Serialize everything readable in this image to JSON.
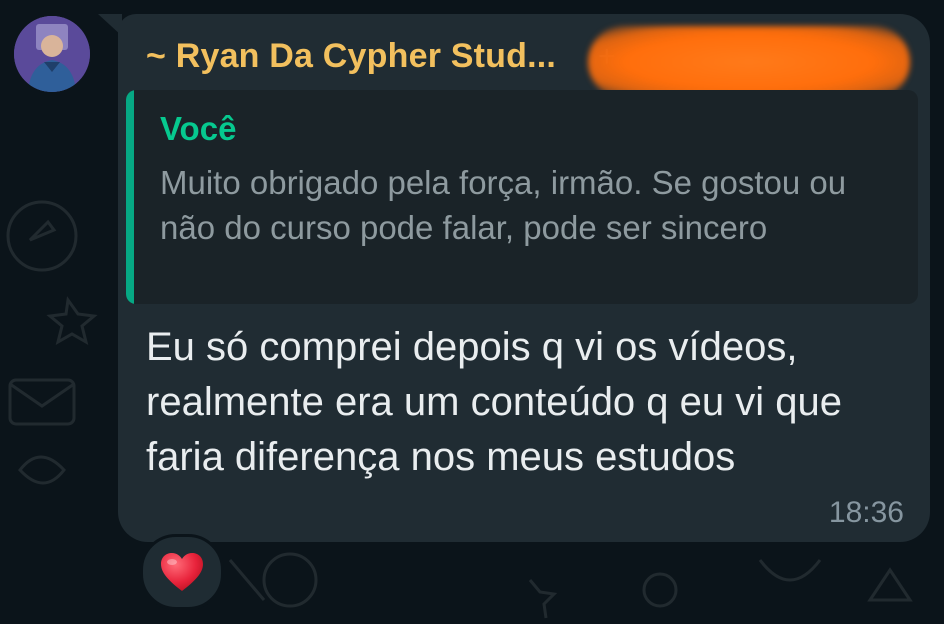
{
  "chat": {
    "sender": {
      "name": "~ Ryan Da Cypher Stud...",
      "phone": "+",
      "name_color": "#f2c05e"
    },
    "quoted_message": {
      "author": "Você",
      "text": "Muito obrigado pela força, irmão. Se gostou ou não do curso pode falar, pode ser sincero",
      "accent_color": "#06a884"
    },
    "message": {
      "text": "Eu só comprei depois q vi os vídeos, realmente era um conteúdo q eu vi que faria diferença nos meus estudos",
      "time": "18:36"
    },
    "reaction": {
      "emoji": "heart-icon"
    }
  },
  "theme": {
    "background": "#0b141a",
    "bubble": "#202c33",
    "redaction": "#ff6e0c"
  }
}
